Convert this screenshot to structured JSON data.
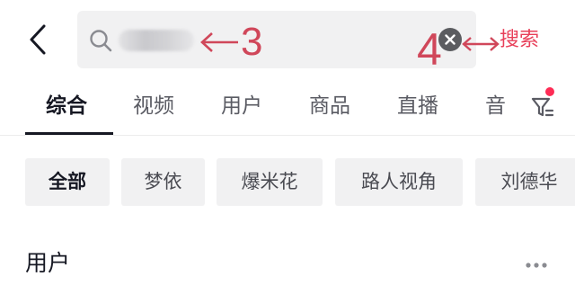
{
  "header": {
    "search_button_label": "搜索",
    "annotations": {
      "query_marker": "3",
      "clear_marker": "4"
    }
  },
  "tabs": [
    {
      "label": "综合",
      "active": true
    },
    {
      "label": "视频",
      "active": false
    },
    {
      "label": "用户",
      "active": false
    },
    {
      "label": "商品",
      "active": false
    },
    {
      "label": "直播",
      "active": false
    },
    {
      "label": "音",
      "active": false
    }
  ],
  "chips": [
    {
      "label": "全部",
      "active": true
    },
    {
      "label": "梦依",
      "active": false
    },
    {
      "label": "爆米花",
      "active": false
    },
    {
      "label": "路人视角",
      "active": false
    },
    {
      "label": "刘德华",
      "active": false
    }
  ],
  "section": {
    "title": "用户"
  },
  "colors": {
    "accent": "#fe2c55",
    "annotation": "#d0475a",
    "search_bg": "#f1f1f2"
  },
  "icons": [
    "back-icon",
    "search-icon",
    "clear-icon",
    "filter-icon",
    "more-icon"
  ]
}
